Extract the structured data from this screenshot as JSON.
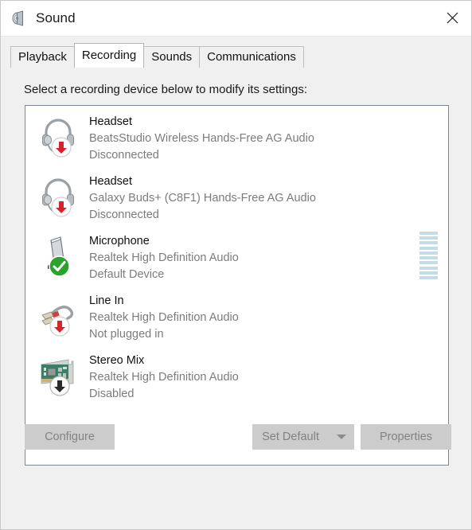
{
  "window": {
    "title": "Sound",
    "icon": "speaker-icon",
    "close_label": "×"
  },
  "tabs": [
    {
      "label": "Playback",
      "active": false
    },
    {
      "label": "Recording",
      "active": true
    },
    {
      "label": "Sounds",
      "active": false
    },
    {
      "label": "Communications",
      "active": false
    }
  ],
  "instruction": "Select a recording device below to modify its settings:",
  "devices": [
    {
      "name": "Headset",
      "description": "BeatsStudio Wireless Hands-Free AG Audio",
      "status": "Disconnected",
      "icon": "headset-icon",
      "badge": "red-down-arrow-badge",
      "meter": false
    },
    {
      "name": "Headset",
      "description": "Galaxy Buds+ (C8F1) Hands-Free AG Audio",
      "status": "Disconnected",
      "icon": "headset-icon",
      "badge": "red-down-arrow-badge",
      "meter": false
    },
    {
      "name": "Microphone",
      "description": "Realtek High Definition Audio",
      "status": "Default Device",
      "icon": "microphone-icon",
      "badge": "green-check-badge",
      "meter": true
    },
    {
      "name": "Line In",
      "description": "Realtek High Definition Audio",
      "status": "Not plugged in",
      "icon": "line-in-jack-icon",
      "badge": "red-down-arrow-badge",
      "meter": false
    },
    {
      "name": "Stereo Mix",
      "description": "Realtek High Definition Audio",
      "status": "Disabled",
      "icon": "sound-card-icon",
      "badge": "black-down-arrow-badge",
      "meter": false
    }
  ],
  "meter": {
    "segments": 10,
    "active_segments": 10,
    "color": "#c3dce5"
  },
  "buttons": {
    "configure": "Configure",
    "set_default": "Set Default",
    "set_default_dropdown": "chevron-down-icon",
    "properties": "Properties"
  },
  "colors": {
    "window_bg": "#f0f0f0",
    "list_bg": "#ffffff",
    "button_disabled_bg": "#cccccc",
    "button_disabled_text": "#838383",
    "meter_blue": "#c3dce5",
    "status_green": "#2aa32a",
    "status_red": "#d9232a"
  }
}
